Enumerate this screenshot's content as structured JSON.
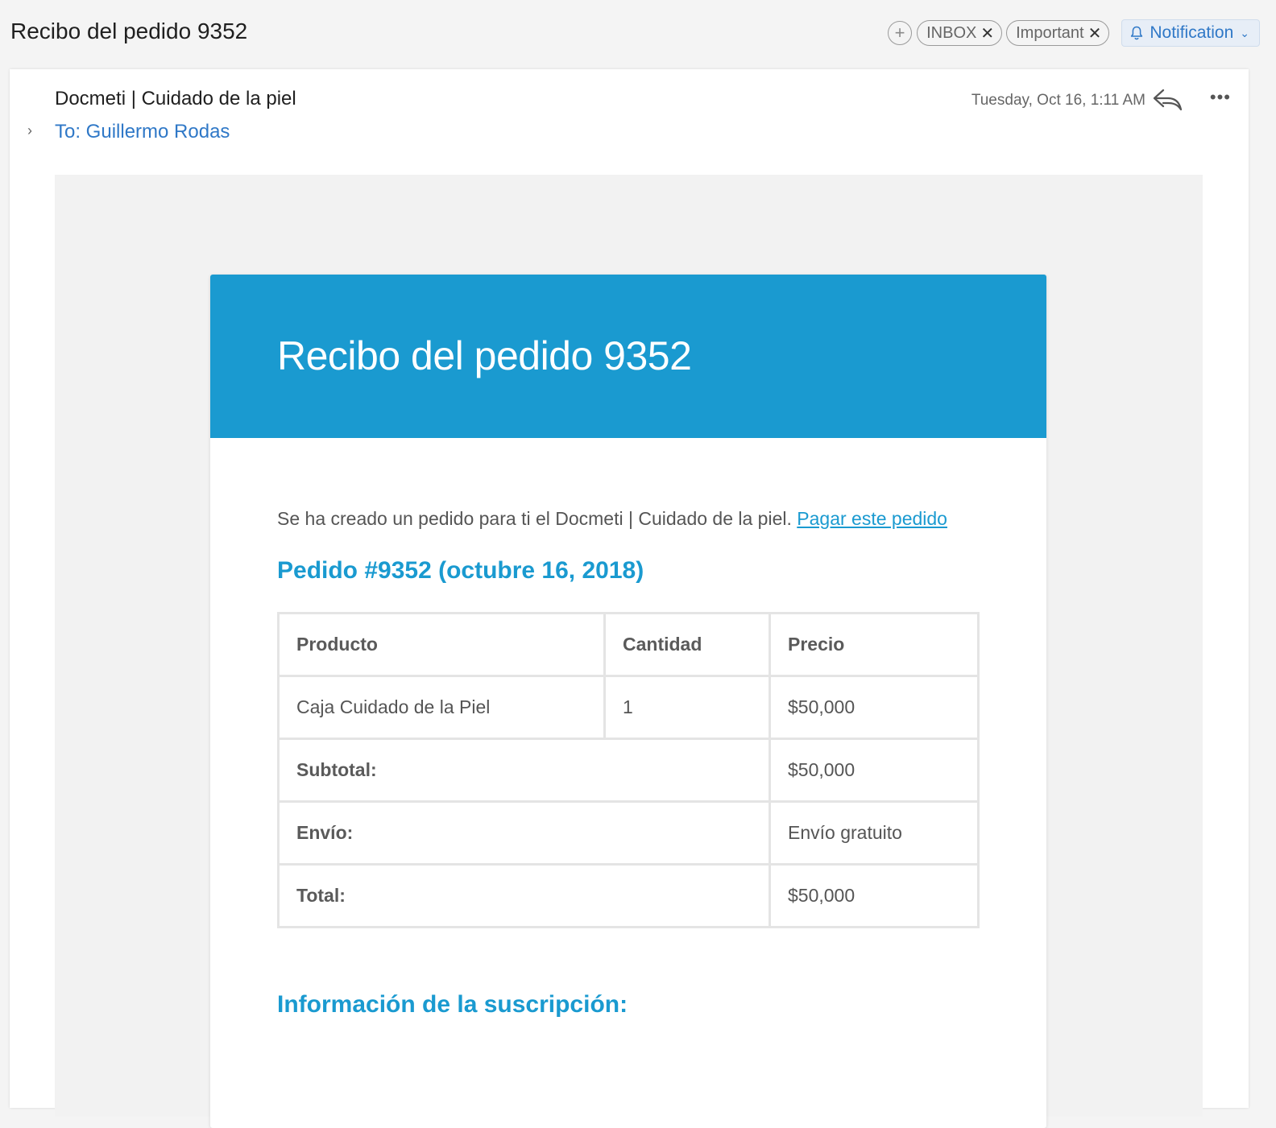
{
  "header": {
    "subject": "Recibo del pedido 9352",
    "tags": [
      {
        "label": "INBOX"
      },
      {
        "label": "Important"
      }
    ],
    "add_tag_icon": "plus-icon",
    "notification_label": "Notification"
  },
  "message": {
    "sender": "Docmeti | Cuidado de la piel",
    "to": "To: Guillermo Rodas",
    "date": "Tuesday, Oct 16, 1:11 AM",
    "reply_icon": "reply-icon",
    "more_icon": "more-icon"
  },
  "email": {
    "header_color": "#1a9ad0",
    "title": "Recibo del pedido 9352",
    "intro_text": "Se ha creado un pedido para ti el Docmeti | Cuidado de la piel. ",
    "intro_link": "Pagar este pedido",
    "order_heading": "Pedido #9352 (octubre 16, 2018)",
    "table": {
      "headers": [
        "Producto",
        "Cantidad",
        "Precio"
      ],
      "item": {
        "product": "Caja Cuidado de la Piel",
        "qty": "1",
        "price": "$50,000"
      },
      "subtotal": {
        "label": "Subtotal:",
        "value": "$50,000"
      },
      "shipping": {
        "label": "Envío:",
        "value": "Envío gratuito"
      },
      "total": {
        "label": "Total:",
        "value": "$50,000"
      }
    },
    "subscription_heading": "Información de la suscripción:"
  }
}
